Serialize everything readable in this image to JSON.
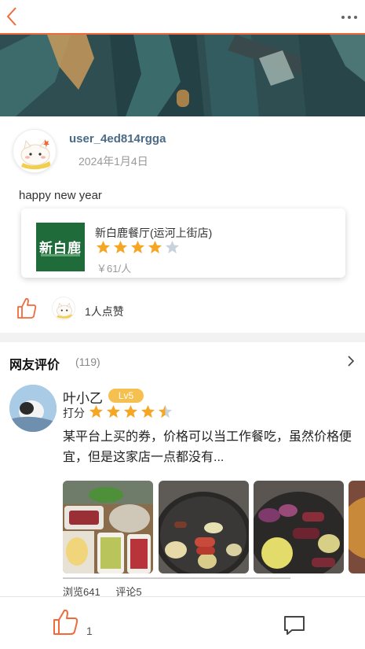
{
  "header": {
    "back_icon": "chevron-left-icon",
    "more_icon": "ellipsis-icon",
    "accent_color": "#f26a3a"
  },
  "post": {
    "username": "user_4ed814rgga",
    "date": "2024年1月4日",
    "text": "happy new year"
  },
  "shop": {
    "logo_text": "新白鹿",
    "name": "新白鹿餐厅(运河上街店)",
    "rating": 4,
    "rating_max": 5,
    "price": "￥61/人"
  },
  "likes": {
    "count_text": "1人点赞"
  },
  "reviews": {
    "title": "网友评价",
    "count": "(119)",
    "items": [
      {
        "name": "叶小乙",
        "level": "Lv5",
        "score_label": "打分",
        "rating": 4.5,
        "text": "某平台上买的券，价格可以当工作餐吃，虽然价格便宜，但是这家店一点都没有...",
        "views": "浏览641",
        "comments": "评论5"
      }
    ]
  },
  "bottom": {
    "like_count": "1",
    "comment_icon": "comment-icon"
  },
  "colors": {
    "star_filled": "#f5a623",
    "star_empty": "#c8d2dc",
    "username": "#4a6a86",
    "badge": "#f5c04f"
  }
}
